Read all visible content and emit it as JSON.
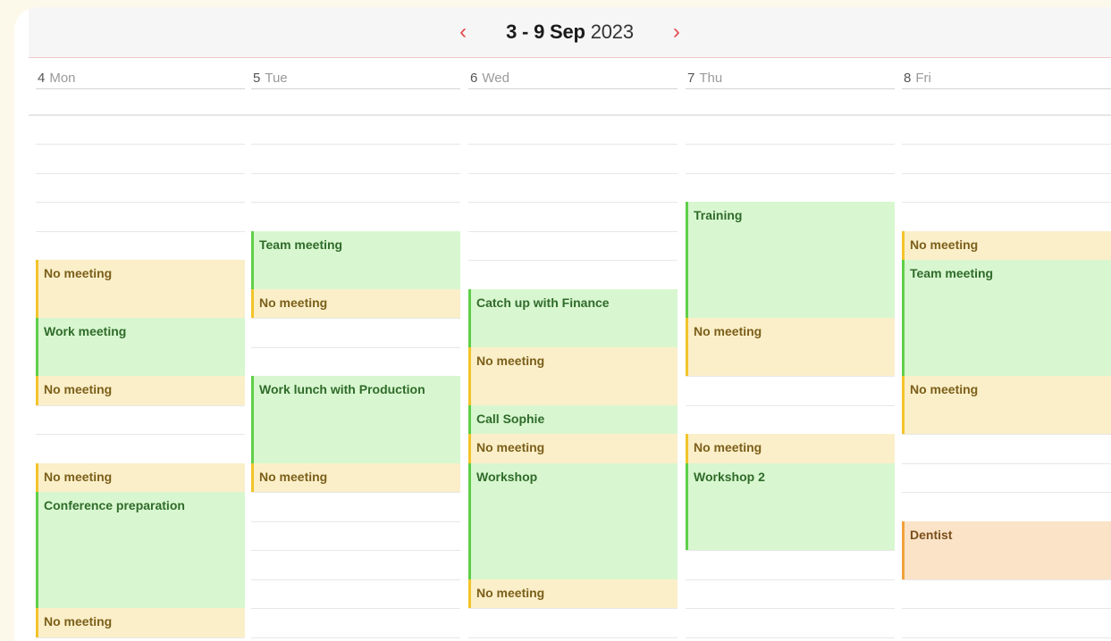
{
  "header": {
    "range_bold": "3 - 9 Sep",
    "range_year": "2023",
    "prev_glyph": "‹",
    "next_glyph": "›"
  },
  "days": [
    {
      "num": "4",
      "name": "Mon"
    },
    {
      "num": "5",
      "name": "Tue"
    },
    {
      "num": "6",
      "name": "Wed"
    },
    {
      "num": "7",
      "name": "Thu"
    },
    {
      "num": "8",
      "name": "Fri"
    }
  ],
  "events": [
    {
      "day": 0,
      "label": "No meeting",
      "color": "yellow"
    },
    {
      "day": 0,
      "label": "Work meeting",
      "color": "green"
    },
    {
      "day": 0,
      "label": "No meeting",
      "color": "yellow"
    },
    {
      "day": 0,
      "label": "No meeting",
      "color": "yellow"
    },
    {
      "day": 0,
      "label": "Conference preparation",
      "color": "green"
    },
    {
      "day": 0,
      "label": "No meeting",
      "color": "yellow"
    },
    {
      "day": 1,
      "label": "Team meeting",
      "color": "green"
    },
    {
      "day": 1,
      "label": "No meeting",
      "color": "yellow"
    },
    {
      "day": 1,
      "label": "Work lunch with Production",
      "color": "green"
    },
    {
      "day": 1,
      "label": "No meeting",
      "color": "yellow"
    },
    {
      "day": 2,
      "label": "Catch up with Finance",
      "color": "green"
    },
    {
      "day": 2,
      "label": "No meeting",
      "color": "yellow"
    },
    {
      "day": 2,
      "label": "Call Sophie",
      "color": "green"
    },
    {
      "day": 2,
      "label": "No meeting",
      "color": "yellow"
    },
    {
      "day": 2,
      "label": "Workshop",
      "color": "green"
    },
    {
      "day": 2,
      "label": "No meeting",
      "color": "yellow"
    },
    {
      "day": 3,
      "label": "Training",
      "color": "green"
    },
    {
      "day": 3,
      "label": "No meeting",
      "color": "yellow"
    },
    {
      "day": 3,
      "label": "No meeting",
      "color": "yellow"
    },
    {
      "day": 3,
      "label": "Workshop 2",
      "color": "green"
    },
    {
      "day": 4,
      "label": "No meeting",
      "color": "yellow"
    },
    {
      "day": 4,
      "label": "Team meeting",
      "color": "green"
    },
    {
      "day": 4,
      "label": "No meeting",
      "color": "yellow"
    },
    {
      "day": 4,
      "label": "Dentist",
      "color": "orange"
    }
  ],
  "colors": {
    "accent": "#e5484d",
    "green_bg": "#d8f7d0",
    "green_border": "#5fcf4a",
    "yellow_bg": "#fbefc9",
    "yellow_border": "#f3c42a",
    "orange_bg": "#fbe3c8",
    "orange_border": "#f1a23c"
  }
}
